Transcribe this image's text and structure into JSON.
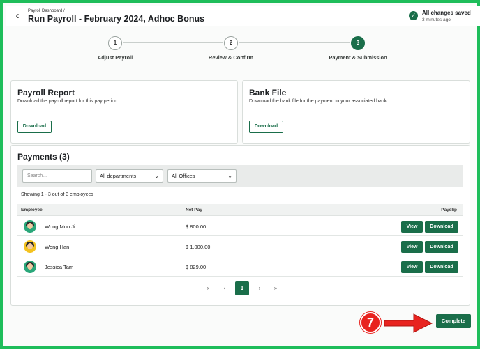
{
  "header": {
    "breadcrumb": "Payroll Dashboard /",
    "title": "Run Payroll - February 2024, Adhoc Bonus",
    "saved_title": "All changes saved",
    "saved_sub": "3 minutes ago"
  },
  "stepper": {
    "steps": [
      {
        "number": "1",
        "label": "Adjust Payroll"
      },
      {
        "number": "2",
        "label": "Review & Confirm"
      },
      {
        "number": "3",
        "label": "Payment & Submission"
      }
    ],
    "active_step": 3
  },
  "payroll_report": {
    "title": "Payroll Report",
    "description": "Download the payroll report for this pay period",
    "button": "Download"
  },
  "bank_file": {
    "title": "Bank File",
    "description": "Download the bank file for the payment to your associated bank",
    "button": "Download"
  },
  "payments": {
    "title": "Payments (3)",
    "search_placeholder": "Search...",
    "department_filter": "All departments",
    "office_filter": "All Offices",
    "showing": "Showing 1 - 3 out of 3 employees",
    "columns": {
      "employee": "Employee",
      "net_pay": "Net Pay",
      "payslip": "Payslip"
    },
    "rows": [
      {
        "name": "Wong Mun Ji",
        "net_pay": "$ 800.00",
        "view": "View",
        "download": "Download"
      },
      {
        "name": "Wong Han",
        "net_pay": "$ 1,000.00",
        "view": "View",
        "download": "Download"
      },
      {
        "name": "Jessica Tam",
        "net_pay": "$ 829.00",
        "view": "View",
        "download": "Download"
      }
    ],
    "pagination": {
      "first": "«",
      "prev": "‹",
      "current": "1",
      "next": "›",
      "last": "»"
    }
  },
  "footer": {
    "complete_button": "Complete",
    "annotation_number": "7"
  },
  "colors": {
    "brand": "#1a6e4a",
    "frame": "#1ebd5a",
    "annotation": "#e8231f"
  },
  "icons": [
    "back-arrow-icon",
    "check-circle-icon",
    "chevron-down-icon",
    "arrow-right-icon"
  ]
}
